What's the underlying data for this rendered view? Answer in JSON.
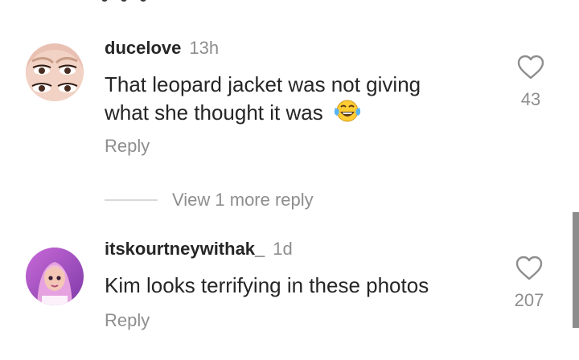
{
  "comments": [
    {
      "username": "ducelove",
      "time": "13h",
      "text_line1": "That leopard jacket was not giving",
      "text_line2": "what she thought it was",
      "emoji": "😂",
      "reply_label": "Reply",
      "like_count": "43"
    },
    {
      "username": "itskourtneywithak_",
      "time": "1d",
      "text_line1": "Kim looks terrifying in these photos",
      "reply_label": "Reply",
      "like_count": "207"
    }
  ],
  "view_more_replies": "View 1 more reply",
  "icons": {
    "like": "heart-outline-icon"
  },
  "colors": {
    "text": "#262626",
    "muted": "#8e8e8e"
  }
}
